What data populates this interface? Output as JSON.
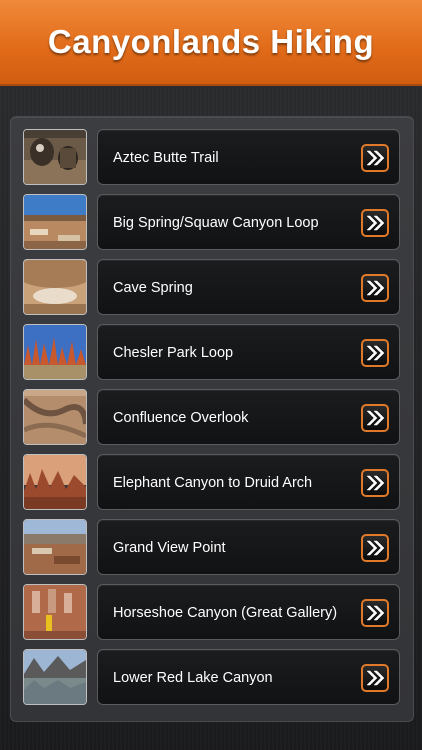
{
  "header": {
    "title": "Canyonlands Hiking"
  },
  "trails": [
    {
      "name": "Aztec Butte Trail"
    },
    {
      "name": "Big Spring/Squaw Canyon Loop"
    },
    {
      "name": "Cave Spring"
    },
    {
      "name": "Chesler Park Loop"
    },
    {
      "name": "Confluence Overlook"
    },
    {
      "name": "Elephant Canyon to Druid Arch"
    },
    {
      "name": "Grand View Point"
    },
    {
      "name": "Horseshoe Canyon (Great Gallery)"
    },
    {
      "name": "Lower Red Lake Canyon"
    }
  ],
  "icons": {
    "row_action": "double-chevron-right-icon"
  },
  "colors": {
    "accent": "#e8762a",
    "header_top": "#f08a3a",
    "header_bottom": "#d15d12"
  }
}
